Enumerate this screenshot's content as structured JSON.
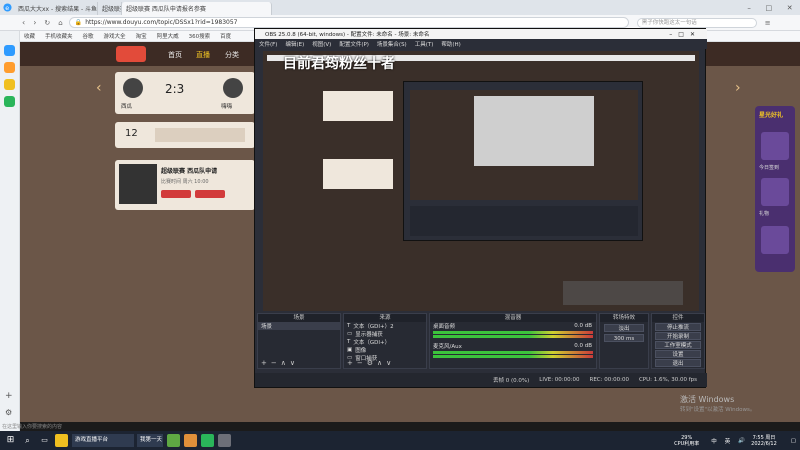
{
  "browser": {
    "tabs": [
      {
        "label": "西瓜大大xx - 搜索结果 - 斗鱼"
      },
      {
        "label": "超级联赛 - 斗鱼直播"
      },
      {
        "label": "超级联赛 西瓜队申请报名参赛"
      }
    ],
    "url": "https://www.douyu.com/topic/DSSx1?rid=1983057",
    "search_placeholder": "黑子你快跑这太一句话",
    "bookmarks": [
      "收藏",
      "手机收藏夹",
      "谷歌",
      "游戏大全",
      "淘宝",
      "阿里大威",
      "360搜索",
      "百度"
    ]
  },
  "site": {
    "nav": [
      "首页",
      "直播",
      "分类"
    ],
    "score": "2:3",
    "teams": [
      "西瓜",
      "嗨嗨"
    ],
    "rank": "12",
    "promo_title": "超级联赛 西瓜队申请",
    "promo_sub": "比赛时间 周六 10:00"
  },
  "obs": {
    "title": "OBS 25.0.8 (64-bit, windows) - 配置文件: 未命名 - 场景: 未命名",
    "menu": [
      "文件(F)",
      "编辑(E)",
      "视图(V)",
      "配置文件(P)",
      "场景集合(S)",
      "工具(T)",
      "帮助(H)"
    ],
    "overlay_text": "目前君筠粉丝十者",
    "docks": {
      "scenes": "场景",
      "sources": "来源",
      "mixer": "混音器",
      "transitions": "转场特效",
      "controls": "控件"
    },
    "scene_item": "场景",
    "sources_list": [
      "文本（GDI+）2",
      "显示器捕获",
      "文本（GDI+）",
      "图像",
      "窗口捕获"
    ],
    "mixer_tracks": [
      {
        "name": "桌面音频",
        "db": "0.0 dB"
      },
      {
        "name": "麦克风/Aux",
        "db": "0.0 dB"
      }
    ],
    "transition": {
      "name": "淡出",
      "duration": "300 ms"
    },
    "control_buttons": [
      "停止推流",
      "开始录制",
      "工作室模式",
      "设置",
      "退出"
    ],
    "status": {
      "dropped": "丢帧 0 (0.0%)",
      "live": "LIVE: 00:00:00",
      "rec": "REC: 00:00:00",
      "cpu": "CPU: 1.6%, 30.00 fps"
    }
  },
  "site_right": {
    "banner": "星光好礼",
    "items": [
      "今日签到",
      "礼物"
    ]
  },
  "windows_activation": {
    "line1": "激活 Windows",
    "line2": "转到\"设置\"以激活 Windows。"
  },
  "taskbar": {
    "search": "在这里输入你要搜索的内容",
    "apps": [
      "游戏直播平台",
      "我第一天"
    ],
    "cpu": "29%",
    "cpu_label": "CPU利用率",
    "tray": [
      "中",
      "英"
    ],
    "time": "7:55 周日",
    "date": "2022/6/12"
  },
  "colors": {
    "site_bg": "#6b5648",
    "obs_bg": "#2b2e38",
    "taskbar": "#1c2432",
    "accent_red": "#d23b3b",
    "accent_yellow": "#f3c623"
  }
}
